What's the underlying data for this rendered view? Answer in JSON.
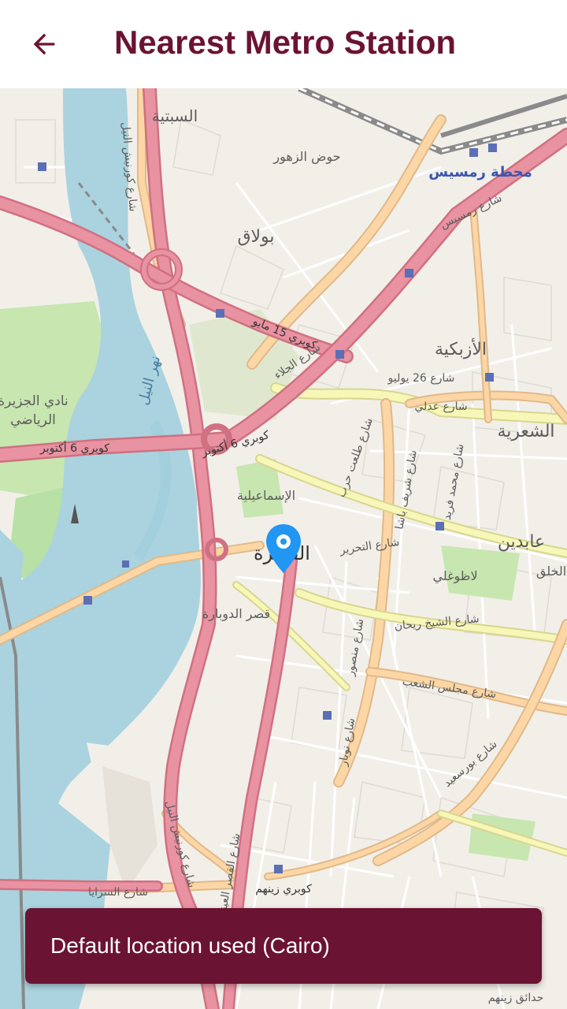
{
  "app_bar": {
    "title": "Nearest Metro Station",
    "back_icon": "arrow-back-icon"
  },
  "map": {
    "marker_icon": "location-pin-icon",
    "labels": {
      "sabtiya": "السبتية",
      "hod_zohour": "حوض الزهور",
      "bulaq": "بولاق",
      "ramses_station": "محطة رمسيس",
      "azbakia": "الأزبكية",
      "shaariya": "الشعرية",
      "gezira_club_1": "نادي الجزيرة",
      "gezira_club_2": "الرياضي",
      "nile_river": "نهر النيل",
      "ismailia": "الإسماعيلية",
      "cairo": "القاهرة",
      "abdeen": "عابدين",
      "bab_el_khalq": "الخلق",
      "lazoghli": "لاظوغلي",
      "qasr_el_dobara": "قصر الدوبارة",
      "bridge_6_october": "كوبري 6 أكتوبر",
      "bridge_15_may": "كوبري 15 مايو",
      "street_26_july": "شارع 26 يوليو",
      "tahrir_st": "شارع التحرير",
      "sheikh_rihan_st": "شارع الشيخ ريحان",
      "majlis_shaab_st": "شارع مجلس الشعب",
      "port_said_st": "شارع بورسعيد",
      "adly_st": "شارع عدلي",
      "qasr_el_aini_st": "شارع القصر العيني",
      "corniche_st": "شارع كورنيش النيل",
      "saray_st": "شارع السرايا",
      "galaa_st": "شارع الجلاء",
      "ramses_st": "شارع رمسيس",
      "mohamed_farid_st": "شارع محمد فريد",
      "talaat_harb_st": "شارع طلعت حرب",
      "sherif_st": "شارع شريف باشا",
      "mansour_st": "شارع منصور",
      "nubar_st": "شارع نوبار",
      "zeinhom_bridge": "كوبري زينهم",
      "sayeda_zeinab": "حدائق زينهم"
    }
  },
  "snackbar": {
    "message": "Default location used (Cairo)"
  },
  "colors": {
    "brand": "#6b1333",
    "water": "#aad3df",
    "park": "#c8e6b0",
    "major_road": "#e892a2",
    "secondary_road": "#fcd6a4",
    "tertiary_road": "#f7f7b8",
    "marker": "#2196f3"
  }
}
